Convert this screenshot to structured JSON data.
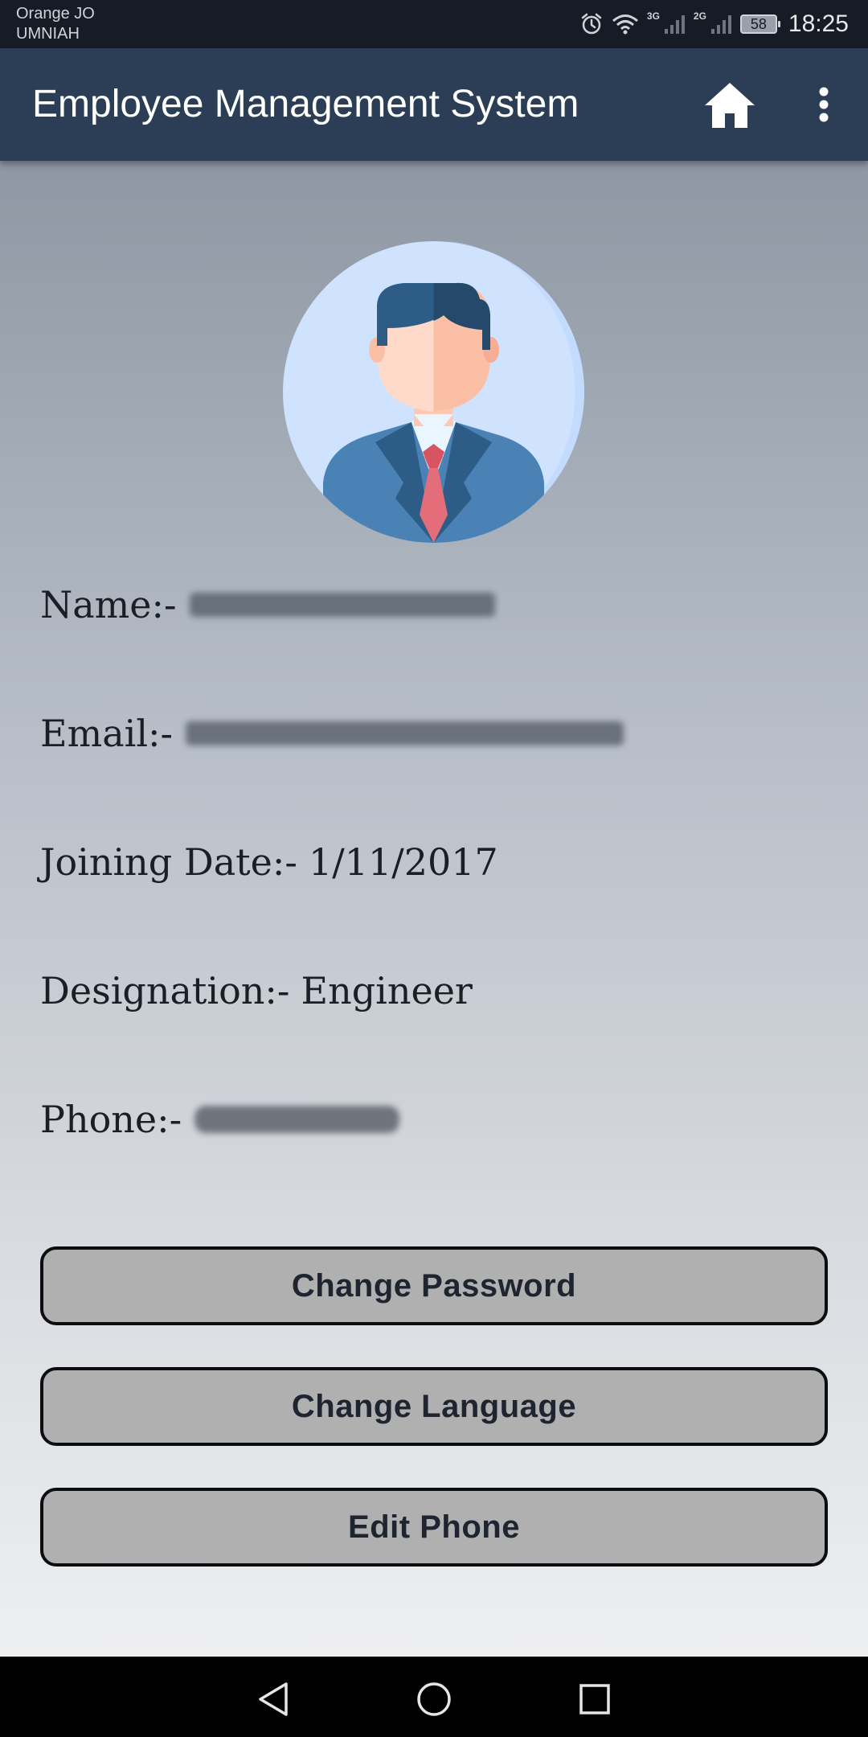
{
  "status_bar": {
    "carrier_line1": "Orange JO",
    "carrier_line2": "UMNIAH",
    "net1": "3G",
    "net2": "2G",
    "battery": "58",
    "time": "18:25",
    "icons": [
      "alarm-icon",
      "wifi-icon",
      "signal-icon",
      "signal-icon",
      "battery-icon"
    ]
  },
  "app_bar": {
    "title": "Employee Management System",
    "icons": [
      "home-icon",
      "more-vert-icon"
    ]
  },
  "profile": {
    "avatar_icon": "employee-avatar-icon",
    "name_label": "Name:-",
    "email_label": "Email:-",
    "joining_label": "Joining Date:-",
    "joining_value": "1/11/2017",
    "designation_label": "Designation:-",
    "designation_value": "Engineer",
    "phone_label": "Phone:-"
  },
  "actions": {
    "change_password": "Change Password",
    "change_language": "Change Language",
    "edit_phone": "Edit Phone"
  },
  "nav_bar": {
    "icons": [
      "back-icon",
      "home-circle-icon",
      "recents-icon"
    ]
  },
  "colors": {
    "app_bar": "#2c3e55",
    "status_bar": "#161b26",
    "button_bg": "#b0b0b0",
    "button_border": "#0c0d10"
  }
}
